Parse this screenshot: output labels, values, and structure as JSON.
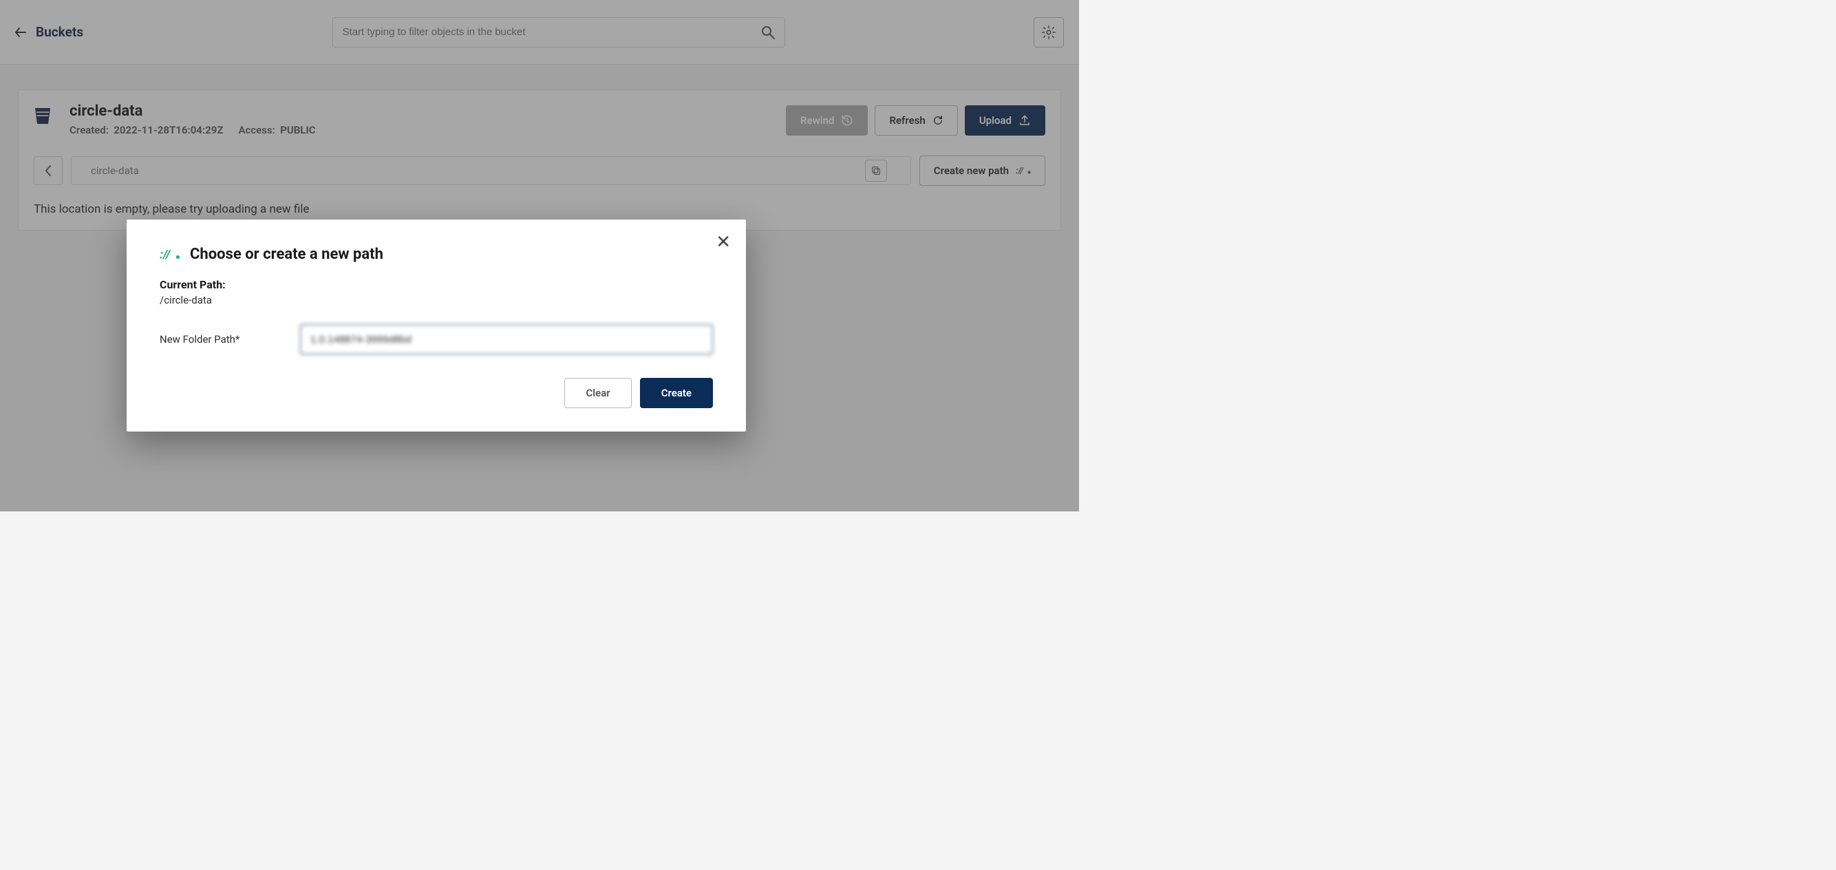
{
  "header": {
    "back_label": "Buckets",
    "search_placeholder": "Start typing to filter objects in the bucket"
  },
  "bucket": {
    "name": "circle-data",
    "created_label": "Created:",
    "created_value": "2022-11-28T16:04:29Z",
    "access_label": "Access:",
    "access_value": "PUBLIC"
  },
  "actions": {
    "rewind": "Rewind",
    "refresh": "Refresh",
    "upload": "Upload",
    "create_path": "Create new path"
  },
  "breadcrumb": {
    "current": "circle-data"
  },
  "empty_message": "This location is empty, please try uploading a new file",
  "modal": {
    "title": "Choose or create a new path",
    "current_path_label": "Current Path:",
    "current_path_value": "/circle-data",
    "field_label": "New Folder Path*",
    "field_value": "1.0.148874-3999d8bd",
    "clear": "Clear",
    "create": "Create"
  }
}
